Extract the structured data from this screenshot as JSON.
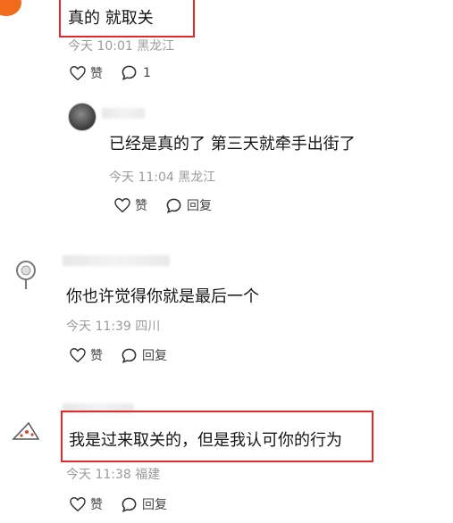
{
  "comments": [
    {
      "text": "真的 就取关",
      "time": "今天 10:01",
      "location": "黑龙江",
      "like_label": "赞",
      "reply_count": "1"
    },
    {
      "text": "已经是真的了 第三天就牵手出街了",
      "time": "今天 11:04",
      "location": "黑龙江",
      "like_label": "赞",
      "reply_label": "回复"
    },
    {
      "text": "你也许觉得你就是最后一个",
      "time": "今天 11:39",
      "location": "四川",
      "like_label": "赞",
      "reply_label": "回复"
    },
    {
      "text": "我是过来取关的，但是我认可你的行为",
      "time": "今天 11:38",
      "location": "福建",
      "like_label": "赞",
      "reply_label": "回复"
    }
  ],
  "colors": {
    "highlight": "#e02b2b",
    "meta": "#9b9b9b",
    "avatar_orange": "#f26a1b"
  }
}
